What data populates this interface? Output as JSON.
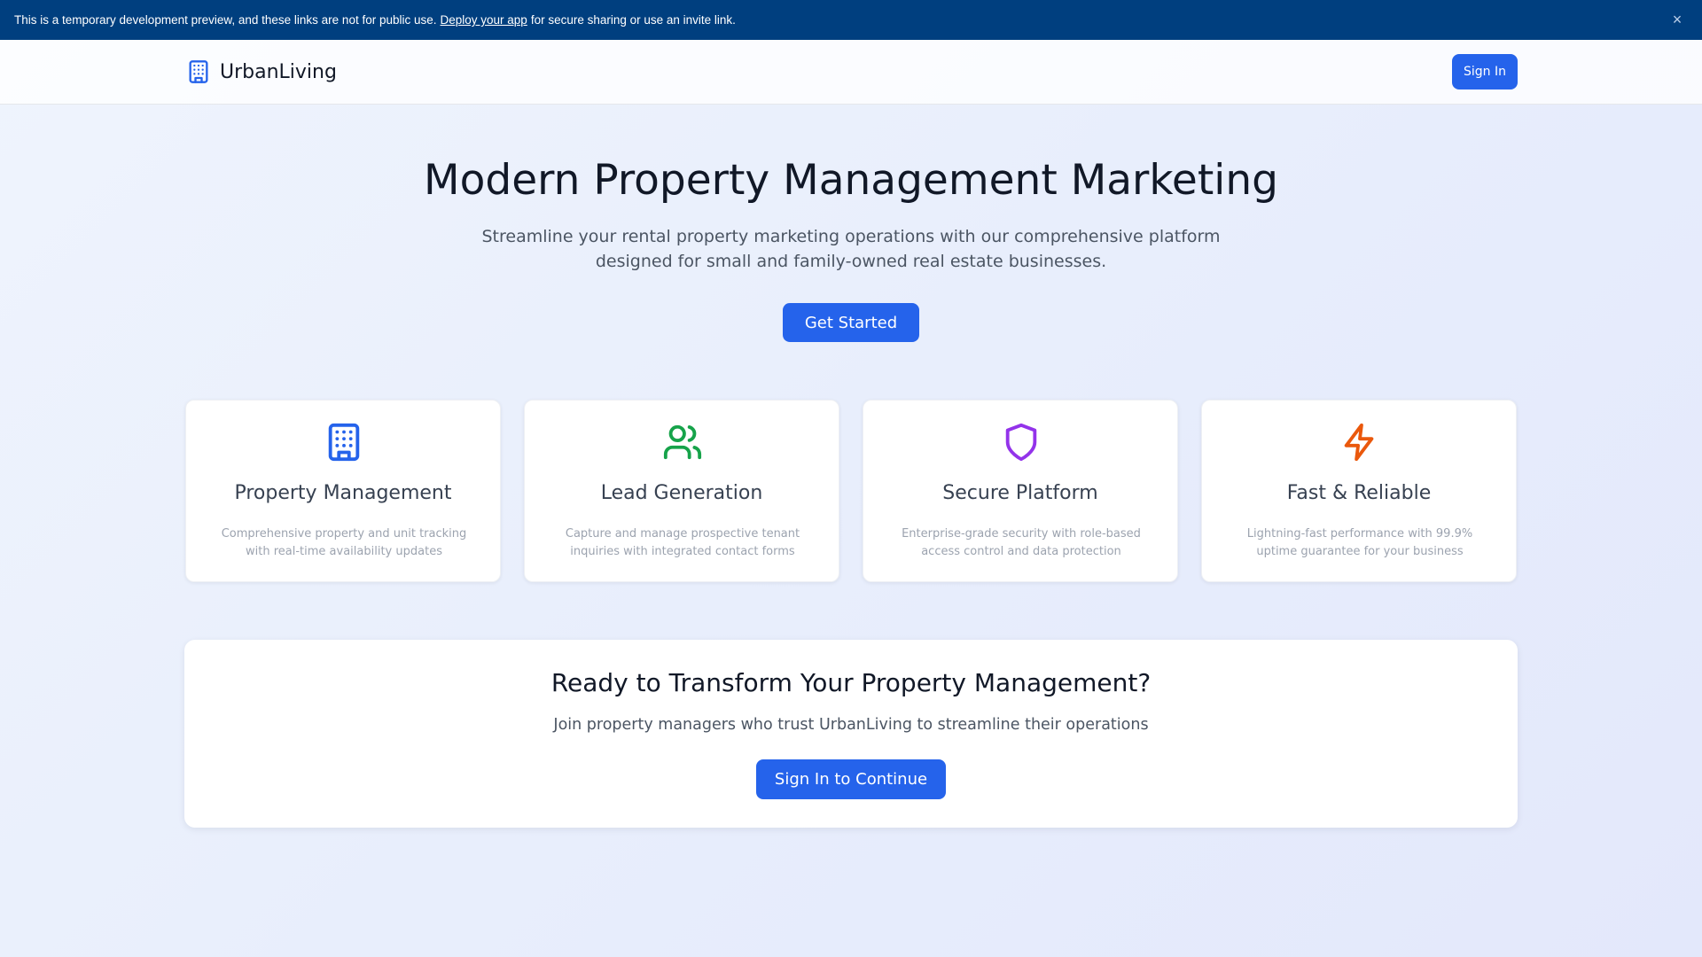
{
  "banner": {
    "text_before": "This is a temporary development preview, and these links are not for public use.",
    "link_text": "Deploy your app",
    "text_after": "for secure sharing or use an invite link.",
    "close_label": "×"
  },
  "header": {
    "brand": "UrbanLiving",
    "sign_in_label": "Sign In"
  },
  "hero": {
    "title": "Modern Property Management Marketing",
    "subtitle": "Streamline your rental property marketing operations with our comprehensive platform designed for small and family-owned real estate businesses.",
    "cta_label": "Get Started"
  },
  "features": [
    {
      "icon": "building-icon",
      "color": "#2563eb",
      "title": "Property Management",
      "description": "Comprehensive property and unit tracking with real-time availability updates"
    },
    {
      "icon": "users-icon",
      "color": "#16a34a",
      "title": "Lead Generation",
      "description": "Capture and manage prospective tenant inquiries with integrated contact forms"
    },
    {
      "icon": "shield-icon",
      "color": "#9333ea",
      "title": "Secure Platform",
      "description": "Enterprise-grade security with role-based access control and data protection"
    },
    {
      "icon": "lightning-icon",
      "color": "#ea580c",
      "title": "Fast & Reliable",
      "description": "Lightning-fast performance with 99.9% uptime guarantee for your business"
    }
  ],
  "cta": {
    "title": "Ready to Transform Your Property Management?",
    "subtitle": "Join property managers who trust UrbanLiving to streamline their operations",
    "button_label": "Sign In to Continue"
  }
}
